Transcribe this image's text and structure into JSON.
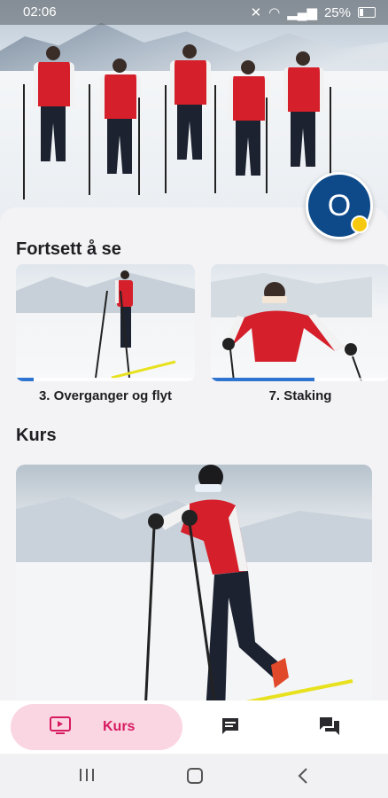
{
  "status_bar": {
    "time": "02:06",
    "battery": "25%"
  },
  "profile": {
    "initial": "O"
  },
  "continue_section": {
    "title": "Fortsett å se",
    "items": [
      {
        "title": "3. Overganger og flyt",
        "progress": 0.1
      },
      {
        "title": "7. Staking",
        "progress": 0.58
      }
    ]
  },
  "courses_section": {
    "title": "Kurs"
  },
  "bottom_nav": {
    "items": [
      {
        "label": "Kurs",
        "icon": "tv-play-icon",
        "active": true
      },
      {
        "label": "",
        "icon": "chat-icon",
        "active": false
      },
      {
        "label": "",
        "icon": "forum-icon",
        "active": false
      }
    ]
  },
  "colors": {
    "accent": "#d81b60",
    "accent_bg": "#fad6e2",
    "progress": "#2f74d0",
    "avatar": "#0e4a8a",
    "badge": "#f6c90e"
  }
}
